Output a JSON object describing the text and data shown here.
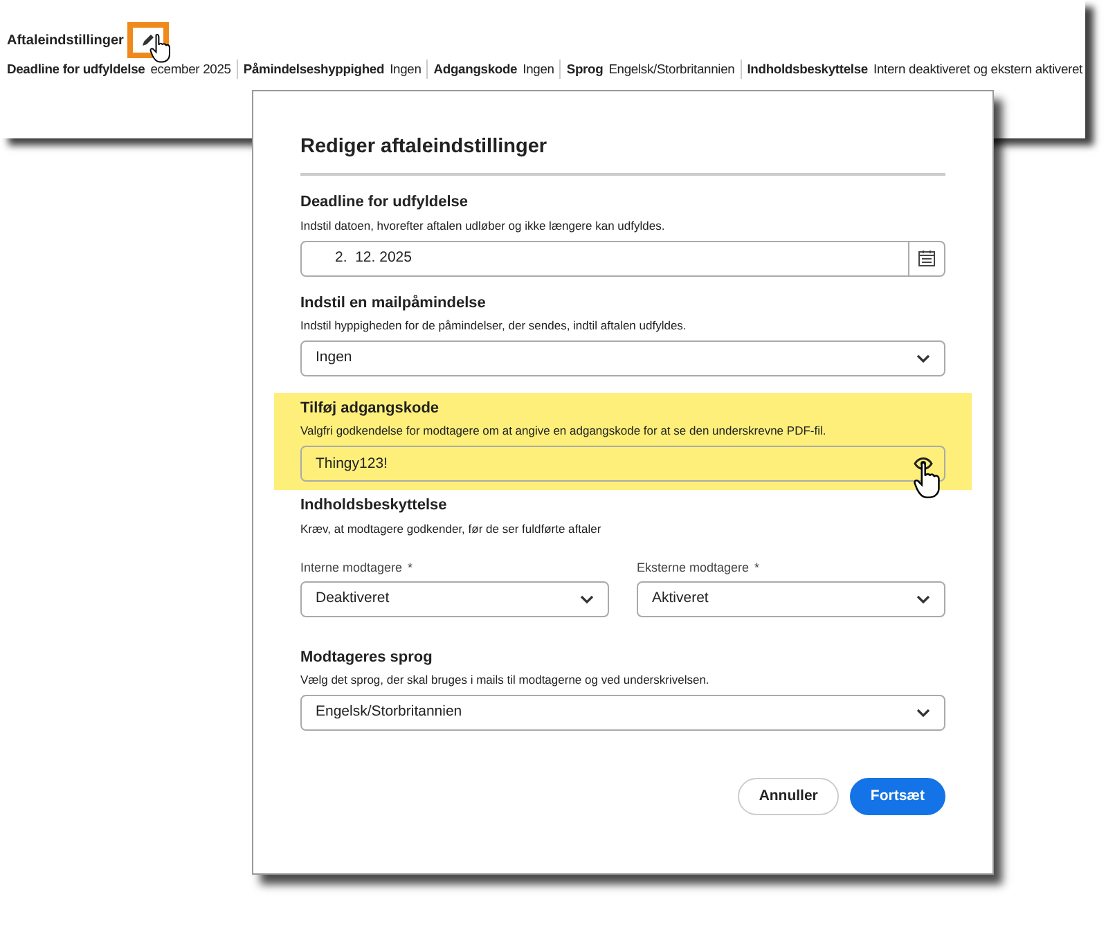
{
  "summary": {
    "title": "Aftaleindstillinger",
    "items": [
      {
        "label": "Deadline for udfyldelse",
        "value": "ecember 2025"
      },
      {
        "label": "Påmindelseshyppighed",
        "value": "Ingen"
      },
      {
        "label": "Adgangskode",
        "value": "Ingen"
      },
      {
        "label": "Sprog",
        "value": "Engelsk/Storbritannien"
      },
      {
        "label": "Indholdsbeskyttelse",
        "value": "Intern deaktiveret og ekstern aktiveret"
      }
    ]
  },
  "dialog": {
    "title": "Rediger aftaleindstillinger",
    "sections": [
      {
        "kind": "date",
        "title": "Deadline for udfyldelse",
        "description": "Indstil datoen, hvorefter aftalen udløber og ikke længere kan udfyldes.",
        "value": "2.  12. 2025"
      },
      {
        "kind": "select",
        "title": "Indstil en mailpåmindelse",
        "description": "Indstil hyppigheden for de påmindelser, der sendes, indtil aftalen udfyldes.",
        "value": "Ingen"
      },
      {
        "kind": "password",
        "highlighted": true,
        "title": "Tilføj adgangskode",
        "description": "Valgfri godkendelse for modtagere om at angive en adgangskode for at se den underskrevne PDF-fil.",
        "value": "Thingy123!"
      },
      {
        "kind": "split",
        "title": "Indholdsbeskyttelse",
        "description": "Kræv, at modtagere godkender, før de ser fuldførte aftaler",
        "fields": [
          {
            "label": "Interne modtagere",
            "required_mark": "*",
            "value": "Deaktiveret"
          },
          {
            "label": "Eksterne modtagere",
            "required_mark": "*",
            "value": "Aktiveret"
          }
        ]
      },
      {
        "kind": "select",
        "title": "Modtageres sprog",
        "description": "Vælg det sprog, der skal bruges i mails til modtagerne og ved underskrivelsen.",
        "value": "Engelsk/Storbritannien"
      }
    ],
    "buttons": [
      {
        "label": "Annuller",
        "kind": "secondary"
      },
      {
        "label": "Fortsæt",
        "kind": "primary"
      }
    ]
  }
}
